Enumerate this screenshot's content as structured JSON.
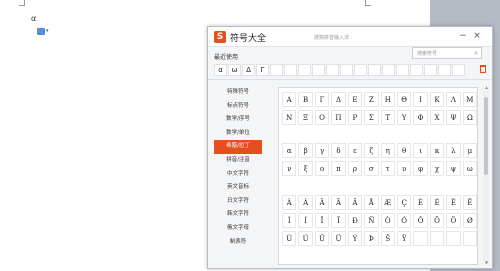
{
  "document": {
    "alpha_char": "α",
    "arrow_char": "▾"
  },
  "dialog": {
    "title": "符号大全",
    "logo": "S",
    "title_hint": "搜狗拼音输入法",
    "search_placeholder": "搜索符号",
    "recent_label": "最近使用",
    "recent_symbols": [
      "α",
      "ω",
      "Δ",
      "Γ",
      "",
      "",
      "",
      "",
      "",
      "",
      "",
      "",
      "",
      "",
      "",
      "",
      "",
      ""
    ],
    "categories": [
      "特殊符号",
      "标点符号",
      "数学/序号",
      "数学/单位",
      "希腊/拉丁",
      "拼音/注音",
      "中文字符",
      "英文音标",
      "日文字符",
      "韩文字符",
      "俄文字母",
      "制表符"
    ],
    "greek_upper": [
      [
        "Α",
        "Β",
        "Γ",
        "Δ",
        "Ε",
        "Ζ",
        "Η",
        "Θ",
        "Ι",
        "Κ",
        "Λ",
        "Μ"
      ],
      [
        "Ν",
        "Ξ",
        "Ο",
        "Π",
        "Ρ",
        "Σ",
        "Τ",
        "Υ",
        "Φ",
        "Χ",
        "Ψ",
        "Ω"
      ]
    ],
    "greek_lower": [
      [
        "α",
        "β",
        "γ",
        "δ",
        "ε",
        "ζ",
        "η",
        "θ",
        "ι",
        "κ",
        "λ",
        "μ"
      ],
      [
        "ν",
        "ξ",
        "ο",
        "π",
        "ρ",
        "σ",
        "τ",
        "υ",
        "φ",
        "χ",
        "ψ",
        "ω"
      ]
    ],
    "latin": [
      [
        "À",
        "Á",
        "Â",
        "Ã",
        "Ä",
        "Å",
        "Æ",
        "Ç",
        "È",
        "É",
        "Ê",
        "Ë"
      ],
      [
        "Ì",
        "Í",
        "Î",
        "Ï",
        "Ð",
        "Ñ",
        "Ò",
        "Ó",
        "Ô",
        "Õ",
        "Ö",
        "Ø"
      ],
      [
        "Ù",
        "Ú",
        "Û",
        "Ü",
        "Ý",
        "Þ",
        "Š",
        "Ÿ",
        "",
        "",
        "",
        ""
      ]
    ],
    "colors": {
      "accent": "#e3501d"
    }
  }
}
